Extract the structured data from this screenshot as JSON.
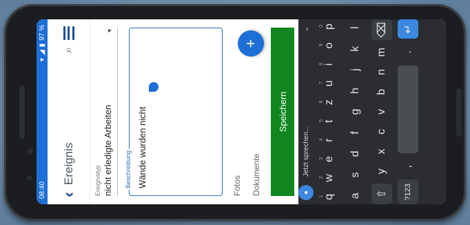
{
  "status": {
    "time": "08:40",
    "battery": "97 %"
  },
  "appbar": {
    "title": "Ereignis"
  },
  "form": {
    "type_label": "Ereignistyp",
    "type_value": "nicht erledigte Arbeiten",
    "desc_label": "Beschreibung",
    "desc_value": "Wände wurden nicht",
    "photos_label": "Fotos",
    "documents_label": "Dokumente",
    "save_label": "Speichern",
    "fab_label": "+"
  },
  "keyboard": {
    "voice_prompt": "Jetzt sprechen...",
    "row1": [
      "q",
      "w",
      "e",
      "r",
      "t",
      "z",
      "u",
      "i",
      "o",
      "p"
    ],
    "row1_alt": [
      "1",
      "2",
      "3",
      "4",
      "5",
      "6",
      "7",
      "8",
      "9",
      "0"
    ],
    "row2": [
      "a",
      "s",
      "d",
      "f",
      "g",
      "h",
      "j",
      "k",
      "l"
    ],
    "row3": [
      "y",
      "x",
      "c",
      "v",
      "b",
      "n",
      "m"
    ],
    "symbols_label": "?123",
    "comma": ",",
    "period": "."
  }
}
